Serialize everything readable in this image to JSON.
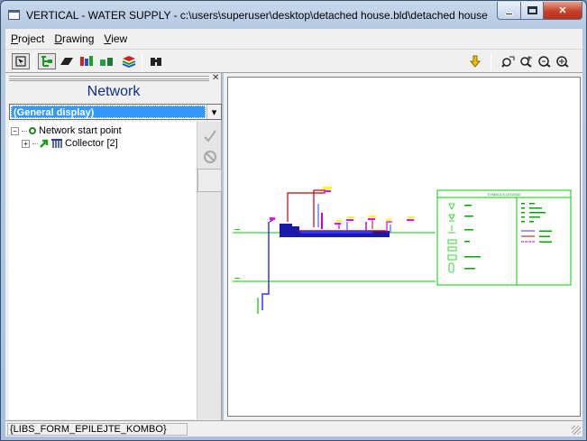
{
  "window": {
    "title": "VERTICAL - WATER SUPPLY - c:\\users\\superuser\\desktop\\detached house.bld\\detached house",
    "minimize": "minimize",
    "maximize": "maximize",
    "close": "✕"
  },
  "menu": [
    {
      "mnemonic": "P",
      "rest": "roject"
    },
    {
      "mnemonic": "D",
      "rest": "rawing"
    },
    {
      "mnemonic": "V",
      "rest": "iew"
    }
  ],
  "toolbar": {
    "icons": [
      "select-icon",
      "network-tree-icon",
      "pipe-icon",
      "valve-icon",
      "fixture-icon",
      "layers-icon",
      "binoculars-icon",
      "download-arrow-icon",
      "zoom-window-icon",
      "zoom-in-icon",
      "zoom-out-icon",
      "zoom-extents-icon"
    ]
  },
  "panel": {
    "title": "Network",
    "close_glyph": "✕",
    "combo_value": "(General display)",
    "combo_arrow": "▾",
    "tree": [
      {
        "label": "Network start point",
        "expander": "−",
        "icon": "network-start-icon"
      },
      {
        "label": "Collector [2]",
        "expander": "+",
        "icon": "collector-icon"
      }
    ],
    "side_buttons": [
      "apply-check-icon",
      "cancel-circle-icon"
    ]
  },
  "drawing": {
    "legend_title": "SYMBOLS LEGEND",
    "colors": {
      "cold_water": "#00cc00",
      "riser": "#3333ff",
      "hot_water": "#cc0000",
      "fixture": "#ff00ff",
      "label": "#ffff00",
      "legend_border": "#00cc00"
    }
  },
  "status": {
    "text": "{LIBS_FORM_EPILEJTE_KOMBO}"
  }
}
